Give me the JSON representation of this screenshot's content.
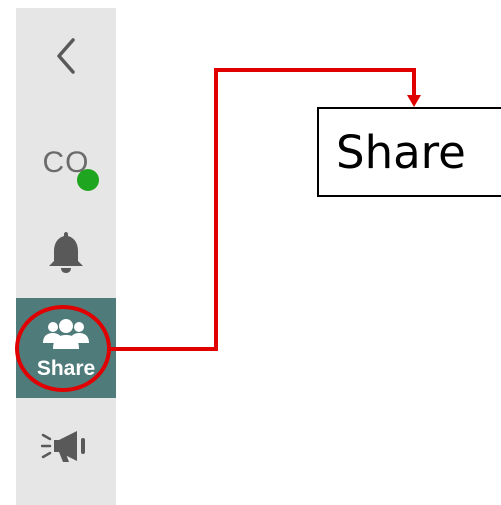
{
  "sidebar": {
    "back_icon": "chevron-left-icon",
    "user": {
      "initials": "CO",
      "presence_color": "#1fa51f"
    },
    "notifications_icon": "bell-icon",
    "share": {
      "icon": "people-icon",
      "label": "Share",
      "active_bg": "#4f7b7a"
    },
    "announce_icon": "megaphone-icon"
  },
  "annotation": {
    "callout_label": "Share",
    "highlight_color": "#e00000"
  }
}
